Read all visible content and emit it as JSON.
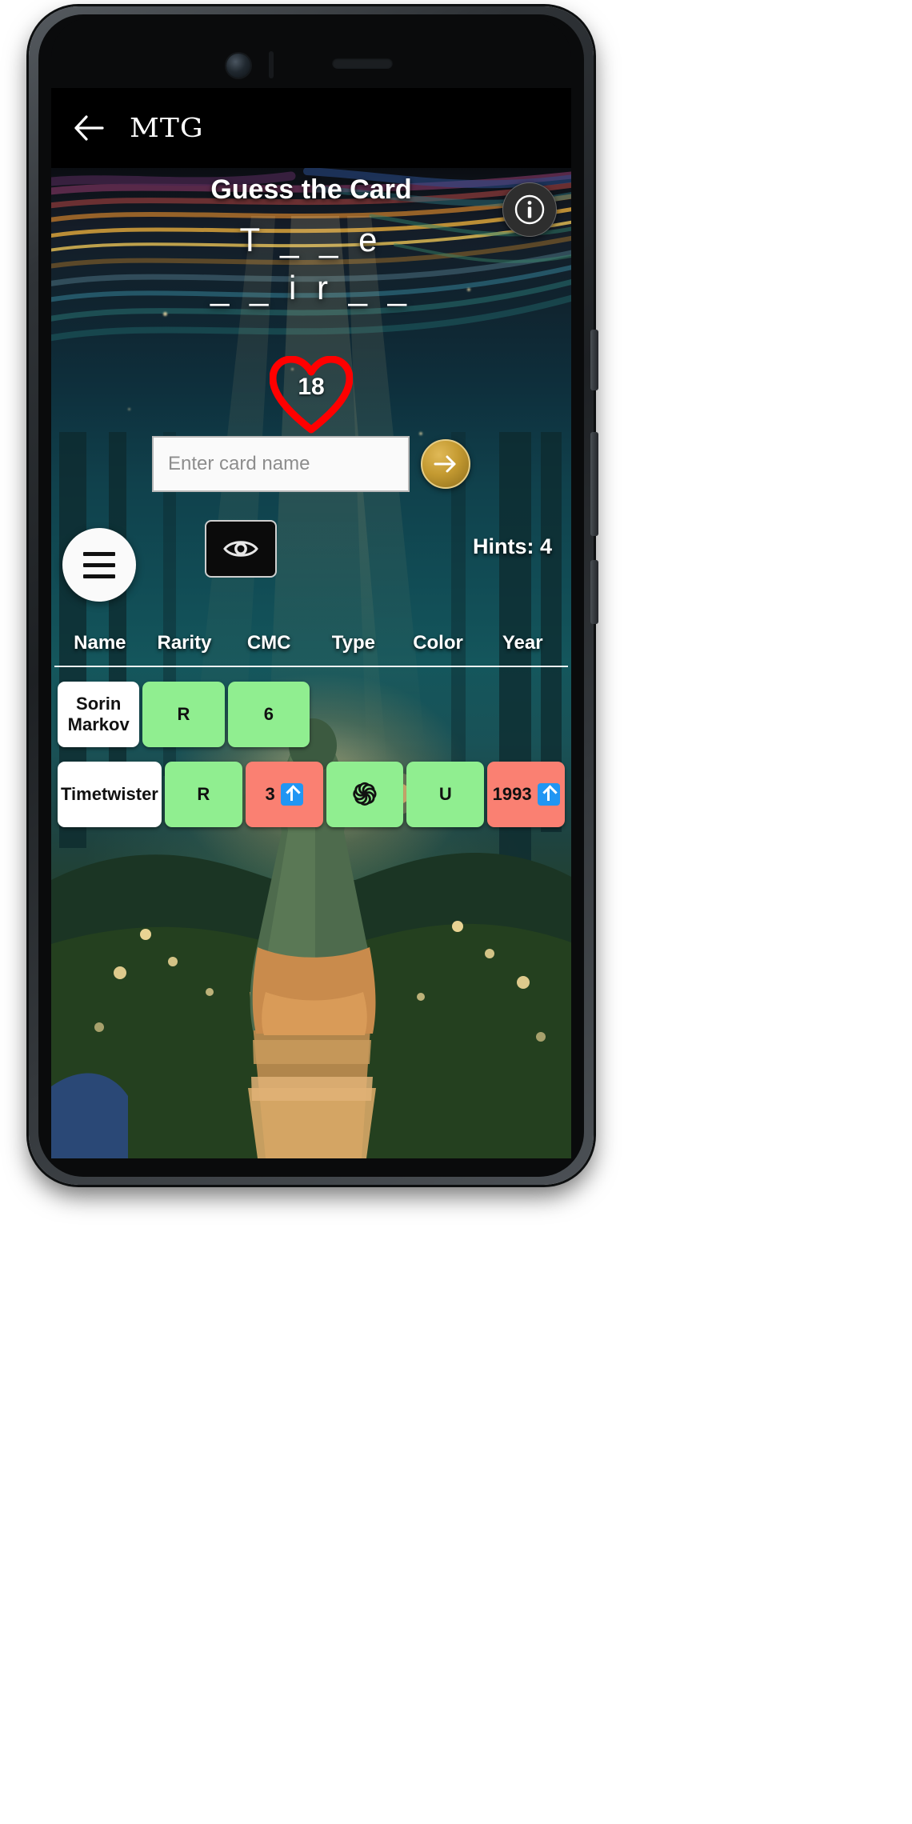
{
  "app": {
    "title": "MTG",
    "back_icon": "back-arrow-icon"
  },
  "game": {
    "heading": "Guess the Card",
    "masked_word_line1": "T _ _ e",
    "masked_word_line2": "_ _ i r _ _",
    "lives": "18",
    "info_icon": "info-icon",
    "heart_icon": "heart-icon"
  },
  "input": {
    "placeholder": "Enter card name",
    "value": "",
    "submit_icon": "arrow-right-icon"
  },
  "hints": {
    "eye_icon": "eye-icon",
    "counter_label": "Hints: 4"
  },
  "menu": {
    "icon": "hamburger-menu-icon"
  },
  "table": {
    "columns": [
      "Name",
      "Rarity",
      "CMC",
      "Type",
      "Color",
      "Year"
    ],
    "rows": [
      {
        "cells": [
          {
            "text": "Sorin Markov",
            "state": "name"
          },
          {
            "text": "R",
            "state": "ok"
          },
          {
            "text": "6",
            "state": "ok"
          },
          {
            "text": "",
            "state": "empty"
          },
          {
            "text": "",
            "state": "empty"
          },
          {
            "text": "",
            "state": "empty"
          }
        ]
      },
      {
        "cells": [
          {
            "text": "Timetwister",
            "state": "name"
          },
          {
            "text": "R",
            "state": "ok"
          },
          {
            "text": "3",
            "state": "bad",
            "hint": "higher"
          },
          {
            "text": "֍",
            "state": "ok",
            "glyph": "sorcery-symbol"
          },
          {
            "text": "U",
            "state": "ok"
          },
          {
            "text": "1993",
            "state": "bad",
            "hint": "higher"
          }
        ]
      }
    ]
  },
  "colors": {
    "correct": "#90EE90",
    "incorrect": "#FA8072",
    "hint_arrow": "#2196F3",
    "heart": "#FF0000",
    "submit": "#C49A31"
  }
}
